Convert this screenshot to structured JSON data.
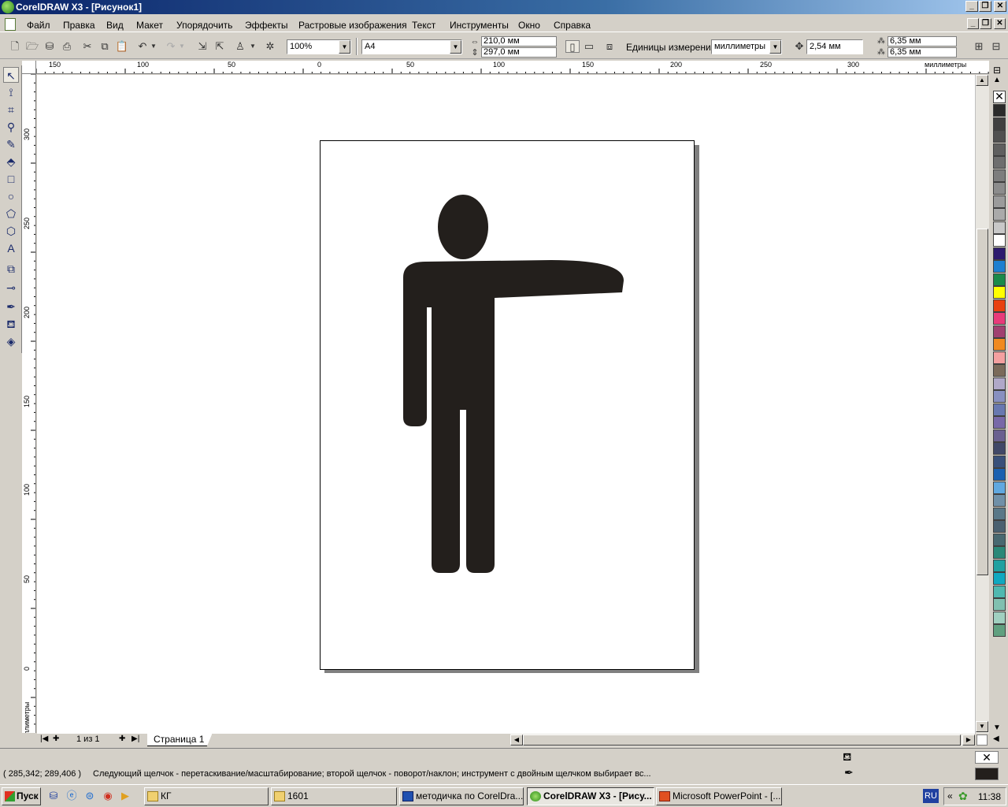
{
  "window": {
    "title": "CorelDRAW X3 - [Рисунок1]",
    "minimize": "_",
    "maximize": "❐",
    "close": "✕"
  },
  "menu": {
    "items": [
      "Файл",
      "Правка",
      "Вид",
      "Макет",
      "Упорядочить",
      "Эффекты",
      "Растровые изображения",
      "Текст",
      "Инструменты",
      "Окно",
      "Справка"
    ]
  },
  "toolbar": {
    "zoom": "100%",
    "paper_size": "A4",
    "width": "210,0 мм",
    "height": "297,0 мм",
    "units_label": "Единицы измерения:",
    "units": "миллиметры",
    "nudge": "2,54 мм",
    "dup_x": "6,35 мм",
    "dup_y": "6,35 мм"
  },
  "ruler": {
    "units_label": "миллиметры",
    "top_ticks": [
      "150",
      "100",
      "50",
      "0",
      "50",
      "100",
      "150",
      "200",
      "250",
      "300"
    ],
    "left_ticks": [
      "300",
      "250",
      "200",
      "150",
      "100",
      "50",
      "0"
    ],
    "left_units": "миллиметры"
  },
  "pages": {
    "counter": "1 из 1",
    "tab": "Страница 1"
  },
  "status": {
    "coords": "( 285,342; 289,406 )",
    "hint": "Следующий щелчок - перетаскивание/масштабирование; второй щелчок - поворот/наклон; инструмент с двойным щелчком выбирает вс..."
  },
  "palette": {
    "colors": [
      "#2a2a2a",
      "#404040",
      "#505050",
      "#5f5f5f",
      "#6e6e6e",
      "#7d7d7d",
      "#8c8c8c",
      "#9b9b9b",
      "#aaaaaa",
      "#c8c8c8",
      "#ffffff",
      "#2d1a6e",
      "#1e7fd0",
      "#1a8a4a",
      "#ffff00",
      "#e84010",
      "#e83a7a",
      "#a04070",
      "#f08a20",
      "#f4a0a0",
      "#7a6a5a",
      "#b0a8c8",
      "#8890c0",
      "#6878b0",
      "#7868a8",
      "#6a6090",
      "#404868",
      "#38507a",
      "#1a60b0",
      "#60a8e0",
      "#7090a8",
      "#5a7888",
      "#4a6070",
      "#486870",
      "#2a8878",
      "#20a0a0",
      "#10a8c0",
      "#50b8b0",
      "#80c0b0",
      "#a0d0c0",
      "#60a080"
    ]
  },
  "taskbar": {
    "start": "Пуск",
    "tasks": [
      "КГ",
      "1601",
      "методичка по CorelDra...",
      "CorelDRAW X3 - [Рису...",
      "Microsoft PowerPoint - [..."
    ],
    "lang": "RU",
    "clock": "11:38"
  }
}
